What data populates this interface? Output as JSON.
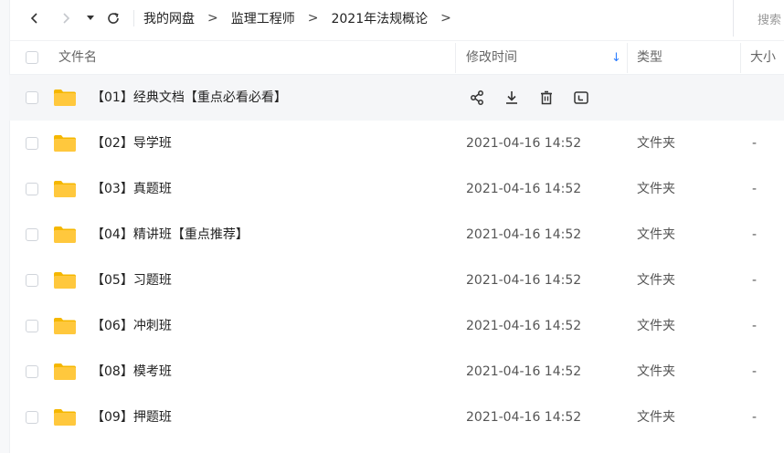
{
  "breadcrumb": {
    "items": [
      "我的网盘",
      "监理工程师",
      "2021年法规概论"
    ],
    "separator": ">",
    "trailing": ">"
  },
  "search": {
    "label": "搜索"
  },
  "columns": {
    "name": "文件名",
    "modified": "修改时间",
    "sort_indicator": "↓",
    "type": "类型",
    "size": "大小"
  },
  "colors": {
    "accent": "#2b7cff",
    "folder": "#ffc83d",
    "folder_tab": "#f5b700",
    "hover_row": "#f5f6f8"
  },
  "files": [
    {
      "name": "【01】经典文档【重点必看必看】",
      "modified": "",
      "type": "",
      "size": "",
      "hovered": true,
      "actions": [
        "share-icon",
        "download-icon",
        "delete-icon",
        "rename-icon"
      ]
    },
    {
      "name": "【02】导学班",
      "modified": "2021-04-16 14:52",
      "type": "文件夹",
      "size": "-"
    },
    {
      "name": "【03】真题班",
      "modified": "2021-04-16 14:52",
      "type": "文件夹",
      "size": "-"
    },
    {
      "name": "【04】精讲班【重点推荐】",
      "modified": "2021-04-16 14:52",
      "type": "文件夹",
      "size": "-"
    },
    {
      "name": "【05】习题班",
      "modified": "2021-04-16 14:52",
      "type": "文件夹",
      "size": "-"
    },
    {
      "name": "【06】冲刺班",
      "modified": "2021-04-16 14:52",
      "type": "文件夹",
      "size": "-"
    },
    {
      "name": "【08】模考班",
      "modified": "2021-04-16 14:52",
      "type": "文件夹",
      "size": "-"
    },
    {
      "name": "【09】押题班",
      "modified": "2021-04-16 14:52",
      "type": "文件夹",
      "size": "-"
    }
  ]
}
